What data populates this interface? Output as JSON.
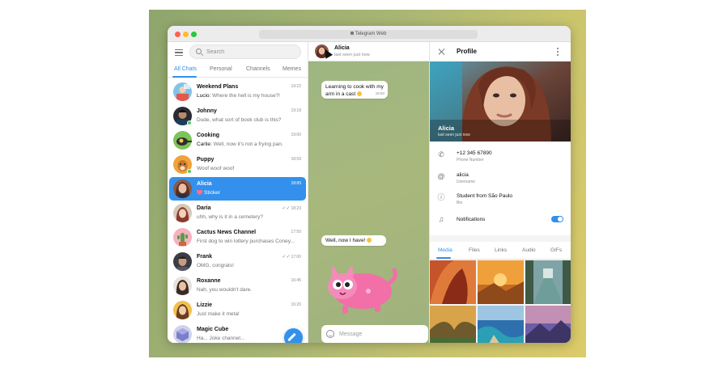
{
  "browser": {
    "url": "Telegram Web"
  },
  "sidebar": {
    "search_placeholder": "Search",
    "tabs": [
      {
        "label": "All Chats",
        "active": true
      },
      {
        "label": "Personal",
        "active": false
      },
      {
        "label": "Channels",
        "active": false
      },
      {
        "label": "Memes",
        "active": false
      }
    ],
    "chats": [
      {
        "name": "Weekend Plans",
        "sender": "Lucio:",
        "preview": "Where the hell is my house?!",
        "time": "19:22"
      },
      {
        "name": "Johnny",
        "sender": "",
        "preview": "Dude, what sort of book club is this?",
        "time": "19:18"
      },
      {
        "name": "Cooking",
        "sender": "Carlie:",
        "preview": "Well, now it's not a frying pan.",
        "time": "19:00"
      },
      {
        "name": "Puppy",
        "sender": "",
        "preview": "Woof woof woof",
        "time": "18:59"
      },
      {
        "name": "Alicia",
        "sender": "",
        "preview": "Sticker",
        "time": "18:89"
      },
      {
        "name": "Daria",
        "sender": "",
        "preview": "uhh, why is it in a cemetery?",
        "time": "18:23"
      },
      {
        "name": "Cactus News Channel",
        "sender": "",
        "preview": "First dog to win lottery purchases Coney...",
        "time": "17:50"
      },
      {
        "name": "Frank",
        "sender": "",
        "preview": "OMG, congrats!",
        "time": "17:00"
      },
      {
        "name": "Roxanne",
        "sender": "",
        "preview": "Nah, you wouldn't dare.",
        "time": "16:45"
      },
      {
        "name": "Lizzie",
        "sender": "",
        "preview": "Just make it meta!",
        "time": "16:20"
      },
      {
        "name": "Magic Cube",
        "sender": "",
        "preview": "Ha... Joke channel...",
        "time": ""
      }
    ]
  },
  "chat": {
    "name": "Alicia",
    "status": "last seen just now",
    "messages": [
      {
        "text": "Learning to cook with my arm in a cast",
        "time": "18:50"
      },
      {
        "text": "Well, now I have!",
        "time": ""
      }
    ],
    "composer_placeholder": "Message"
  },
  "profile": {
    "title": "Profile",
    "name": "Alicia",
    "status": "last seen just now",
    "phone": "+12 345 67890",
    "phone_label": "Phone Number",
    "username": "alicia",
    "username_label": "Username",
    "bio": "Student from São Paulo",
    "bio_label": "Bio",
    "notifications_label": "Notifications",
    "notifications_on": true,
    "media_tabs": [
      {
        "label": "Media",
        "active": true
      },
      {
        "label": "Files",
        "active": false
      },
      {
        "label": "Links",
        "active": false
      },
      {
        "label": "Audio",
        "active": false
      },
      {
        "label": "GIFs",
        "active": false
      }
    ]
  },
  "colors": {
    "accent": "#3390ec",
    "online": "#4fce5d",
    "selected_text": "#ffffff"
  }
}
